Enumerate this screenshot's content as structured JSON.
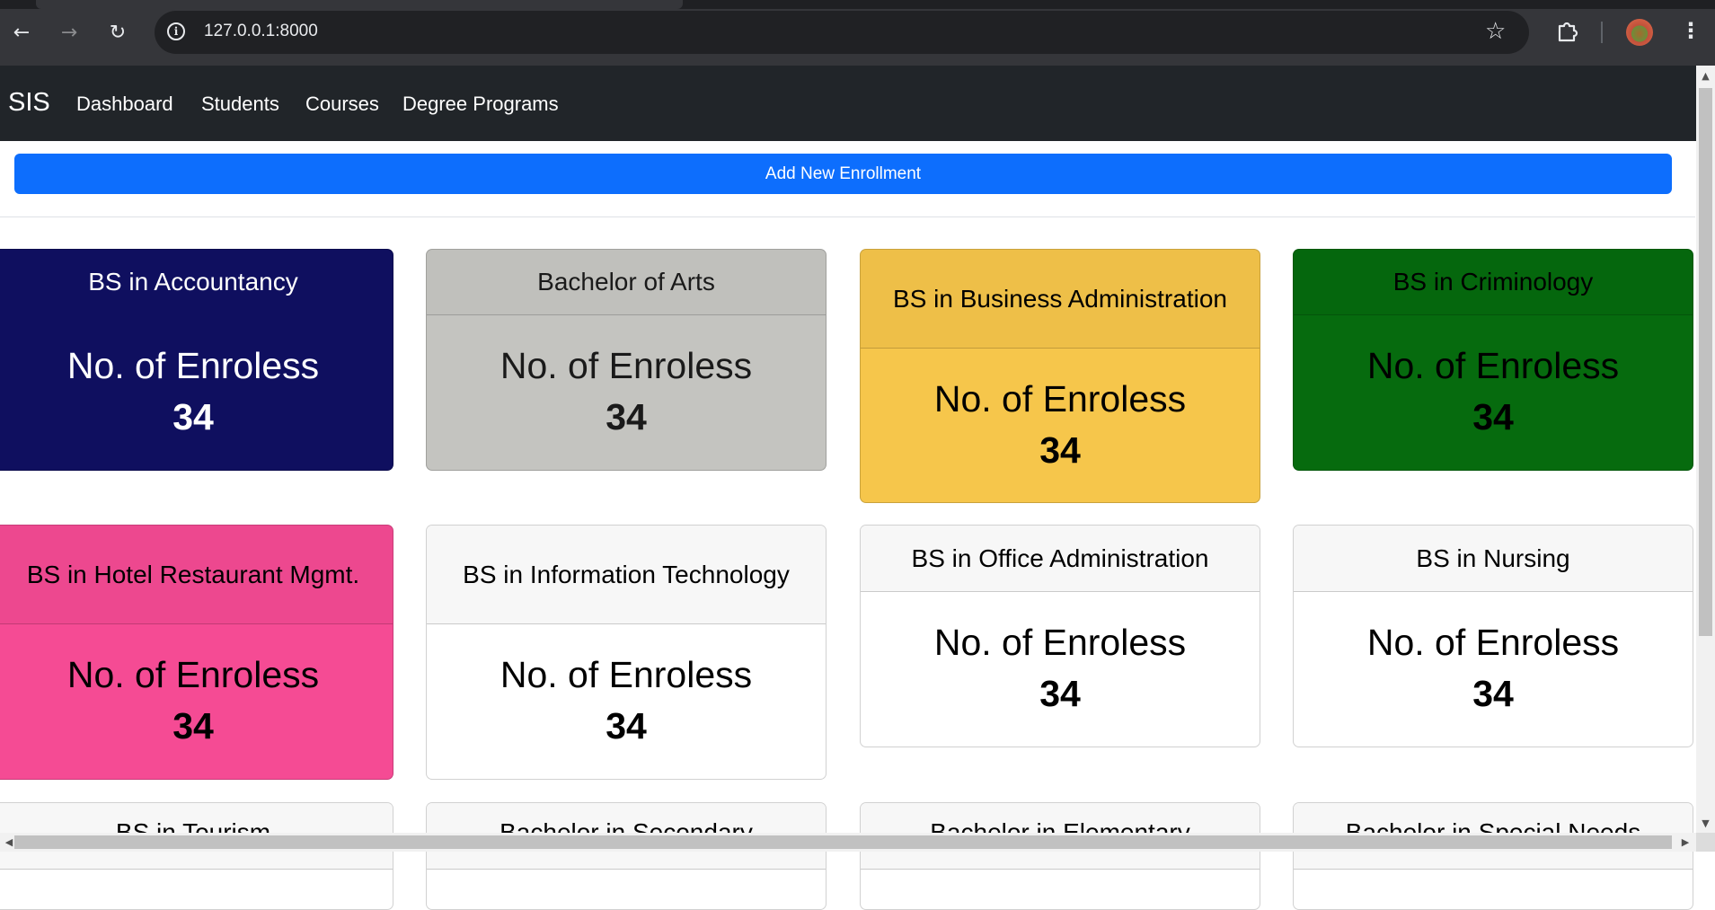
{
  "browser": {
    "url": "127.0.0.1:8000",
    "icons": [
      "back-icon",
      "forward-icon",
      "reload-icon",
      "info-icon",
      "star-icon",
      "extensions-icon",
      "profile-avatar",
      "menu-icon"
    ]
  },
  "navbar": {
    "brand": "SIS",
    "links": [
      "Dashboard",
      "Students",
      "Courses",
      "Degree Programs"
    ]
  },
  "actions": {
    "add_label": "Add New Enrollment"
  },
  "cards": [
    {
      "title": "BS in Accountancy",
      "label": "No. of Enroless",
      "count": "34",
      "bg": "#0f0f5f",
      "text": "#ffffff"
    },
    {
      "title": "Bachelor of Arts",
      "label": "No. of Enroless",
      "count": "34",
      "bg": "#c4c4c0",
      "text": "#1a1a1a"
    },
    {
      "title": "BS in Business Administration",
      "label": "No. of Enroless",
      "count": "34",
      "bg": "#f6c64b",
      "text": "#000000"
    },
    {
      "title": "BS in Criminology",
      "label": "No. of Enroless",
      "count": "34",
      "bg": "#066b0e",
      "text": "#000000"
    },
    {
      "title": "BS in Hotel Restaurant Mgmt.",
      "label": "No. of Enroless",
      "count": "34",
      "bg": "#f54b94",
      "text": "#000000"
    },
    {
      "title": "BS in Information Technology",
      "label": "No. of Enroless",
      "count": "34",
      "bg": "#ffffff",
      "text": "#000000"
    },
    {
      "title": "BS in Office Administration",
      "label": "No. of Enroless",
      "count": "34",
      "bg": "#ffffff",
      "text": "#000000"
    },
    {
      "title": "BS in Nursing",
      "label": "No. of Enroless",
      "count": "34",
      "bg": "#ffffff",
      "text": "#000000"
    },
    {
      "title": "BS in Tourism",
      "bg": "#ffffff",
      "text": "#000000"
    },
    {
      "title": "Bachelor in Secondary",
      "bg": "#ffffff",
      "text": "#000000"
    },
    {
      "title": "Bachelor in Elementary",
      "bg": "#ffffff",
      "text": "#000000"
    },
    {
      "title": "Bachelor in Special Needs",
      "bg": "#ffffff",
      "text": "#000000"
    }
  ]
}
